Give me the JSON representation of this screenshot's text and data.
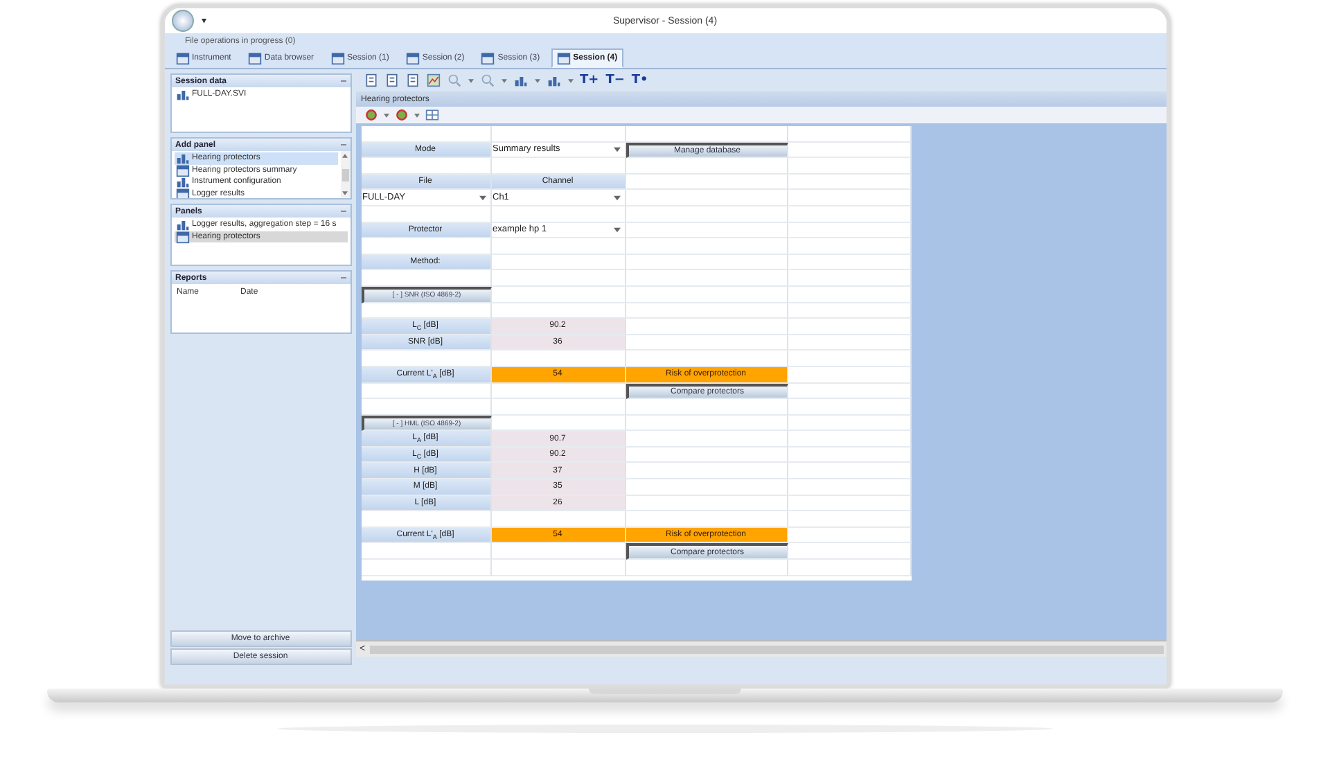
{
  "window": {
    "title": "Supervisor - Session (4)",
    "quick_access": "▾",
    "status": "File operations in progress (0)"
  },
  "tabs": [
    {
      "label": "Instrument",
      "selected": false
    },
    {
      "label": "Data browser",
      "selected": false
    },
    {
      "label": "Session (1)",
      "selected": false
    },
    {
      "label": "Session (2)",
      "selected": false
    },
    {
      "label": "Session (3)",
      "selected": false
    },
    {
      "label": "Session (4)",
      "selected": true
    }
  ],
  "toolbar": {
    "text_buttons": [
      "T+",
      "T−",
      "T•"
    ]
  },
  "sidebar": {
    "sections": [
      {
        "title": "Session data",
        "kind": "list",
        "items": [
          {
            "label": "FULL-DAY.SVI",
            "selected": false
          }
        ]
      },
      {
        "title": "Add panel",
        "kind": "scroll_list",
        "items": [
          {
            "label": "Hearing protectors",
            "selected": true
          },
          {
            "label": "Hearing protectors summary",
            "selected": false
          },
          {
            "label": "Instrument configuration",
            "selected": false
          },
          {
            "label": "Logger results",
            "selected": false
          }
        ]
      },
      {
        "title": "Panels",
        "kind": "list",
        "items": [
          {
            "label": "Logger results, aggregation step = 16 s",
            "selected": false
          },
          {
            "label": "Hearing protectors",
            "selected": true
          }
        ]
      },
      {
        "title": "Reports",
        "kind": "table",
        "columns": [
          "Name",
          "Date"
        ]
      }
    ],
    "buttons": [
      "Move to archive",
      "Delete session"
    ]
  },
  "panel": {
    "title": "Hearing protectors",
    "rows": [
      {
        "kind": "blank"
      },
      {
        "kind": "cells",
        "cells": [
          {
            "kind": "label",
            "text": "Mode"
          },
          {
            "kind": "dropdown",
            "text": "Summary results"
          },
          {
            "kind": "button",
            "text": "Manage database"
          }
        ]
      },
      {
        "kind": "blank"
      },
      {
        "kind": "cells",
        "cells": [
          {
            "kind": "label",
            "text": "File"
          },
          {
            "kind": "label",
            "text": "Channel"
          }
        ]
      },
      {
        "kind": "cells",
        "cells": [
          {
            "kind": "dropdown",
            "text": "FULL-DAY"
          },
          {
            "kind": "dropdown",
            "text": "Ch1"
          }
        ]
      },
      {
        "kind": "blank"
      },
      {
        "kind": "cells",
        "cells": [
          {
            "kind": "label",
            "text": "Protector"
          },
          {
            "kind": "dropdown",
            "text": "example hp 1"
          }
        ]
      },
      {
        "kind": "blank"
      },
      {
        "kind": "cells",
        "cells": [
          {
            "kind": "label",
            "text": "Method:"
          }
        ]
      },
      {
        "kind": "blank"
      },
      {
        "kind": "cells",
        "cells": [
          {
            "kind": "toggle",
            "text": "[ - ] SNR (ISO 4869-2)"
          }
        ]
      },
      {
        "kind": "blank"
      },
      {
        "kind": "cells",
        "cells": [
          {
            "kind": "label",
            "text": "L$_{C}$ [dB]"
          },
          {
            "kind": "value",
            "text": "90.2"
          }
        ]
      },
      {
        "kind": "cells",
        "cells": [
          {
            "kind": "label",
            "text": "SNR [dB]"
          },
          {
            "kind": "value",
            "text": "36"
          }
        ]
      },
      {
        "kind": "blank"
      },
      {
        "kind": "cells",
        "cells": [
          {
            "kind": "label",
            "text": "Current L'$_{A}$ [dB]"
          },
          {
            "kind": "alert",
            "text": "54"
          },
          {
            "kind": "alert",
            "text": "Risk of overprotection"
          }
        ]
      },
      {
        "kind": "cells",
        "cells": [
          {
            "kind": "empty"
          },
          {
            "kind": "empty"
          },
          {
            "kind": "button",
            "text": "Compare protectors"
          }
        ]
      },
      {
        "kind": "blank"
      },
      {
        "kind": "cells",
        "cells": [
          {
            "kind": "toggle",
            "text": "[ - ] HML (ISO 4869-2)"
          }
        ]
      },
      {
        "kind": "cells",
        "cells": [
          {
            "kind": "label",
            "text": "L$_{A}$ [dB]"
          },
          {
            "kind": "value",
            "text": "90.7"
          }
        ]
      },
      {
        "kind": "cells",
        "cells": [
          {
            "kind": "label",
            "text": "L$_{C}$ [dB]"
          },
          {
            "kind": "value",
            "text": "90.2"
          }
        ]
      },
      {
        "kind": "cells",
        "cells": [
          {
            "kind": "label",
            "text": "H [dB]"
          },
          {
            "kind": "value",
            "text": "37"
          }
        ]
      },
      {
        "kind": "cells",
        "cells": [
          {
            "kind": "label",
            "text": "M [dB]"
          },
          {
            "kind": "value",
            "text": "35"
          }
        ]
      },
      {
        "kind": "cells",
        "cells": [
          {
            "kind": "label",
            "text": "L [dB]"
          },
          {
            "kind": "value",
            "text": "26"
          }
        ]
      },
      {
        "kind": "blank"
      },
      {
        "kind": "cells",
        "cells": [
          {
            "kind": "label",
            "text": "Current L'$_{A}$ [dB]"
          },
          {
            "kind": "alert",
            "text": "54"
          },
          {
            "kind": "alert",
            "text": "Risk of overprotection"
          }
        ]
      },
      {
        "kind": "cells",
        "cells": [
          {
            "kind": "empty"
          },
          {
            "kind": "empty"
          },
          {
            "kind": "button",
            "text": "Compare protectors"
          }
        ]
      },
      {
        "kind": "blank"
      }
    ]
  },
  "scrollbar": {
    "arrow": "<"
  }
}
